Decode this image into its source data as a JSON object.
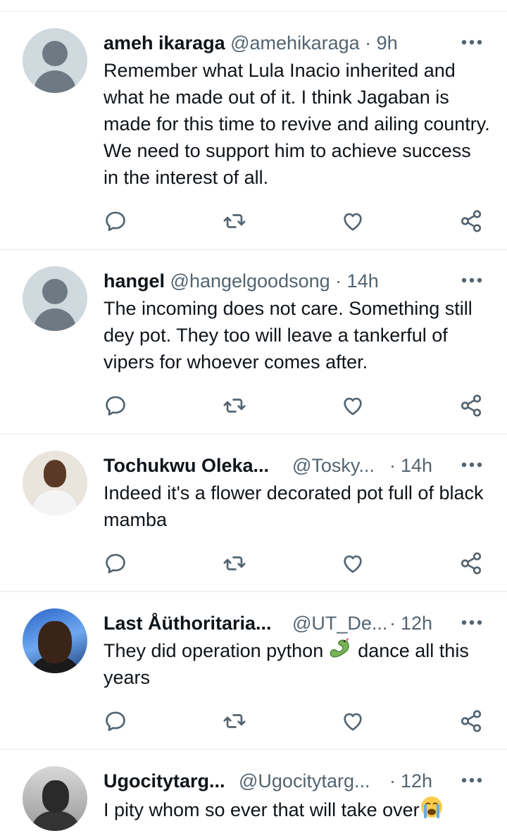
{
  "tweets": [
    {
      "name": "ameh ikaraga",
      "handle": "@amehikaraga",
      "separator": "·",
      "time": "9h",
      "text": "Remember what Lula Inacio inherited and what he made out of it. I think Jagaban is made for this time to revive and ailing country.  We need to support him to achieve success in the interest of all.",
      "avatar": "default-avatar-icon"
    },
    {
      "name": "hangel",
      "handle": "@hangelgoodsong",
      "separator": "·",
      "time": "14h",
      "text": "The incoming does not care. Something still dey pot. They too will leave a tankerful of vipers for whoever comes after.",
      "avatar": "default-avatar-icon"
    },
    {
      "name": "Tochukwu Oleka...",
      "handle": "@Tosky...",
      "separator": "·",
      "time": "14h",
      "text": "Indeed it's a flower decorated pot full of black mamba",
      "avatar": "user-photo"
    },
    {
      "name": "Last Åüthoritaria...",
      "handle": "@UT_De...",
      "separator": "·",
      "time": "12h",
      "text_before": "They did operation python ",
      "text_emoji": "snake-emoji",
      "text_after": " dance all this years",
      "avatar": "user-photo"
    },
    {
      "name": "Ugocitytarg...",
      "handle": "@Ugocitytarg...",
      "separator": "·",
      "time": "12h",
      "text_before": "I pity whom so ever that will take over",
      "text_emoji": "loudly-crying-face-emoji",
      "avatar": "user-photo"
    }
  ],
  "icons": {
    "reply": "reply-icon",
    "repost": "repost-icon",
    "like": "like-icon",
    "share": "share-icon",
    "more": "more-icon"
  },
  "colors": {
    "text": "#0f1419",
    "secondary": "#536471",
    "divider": "#eff3f4",
    "icon": "#536471"
  }
}
